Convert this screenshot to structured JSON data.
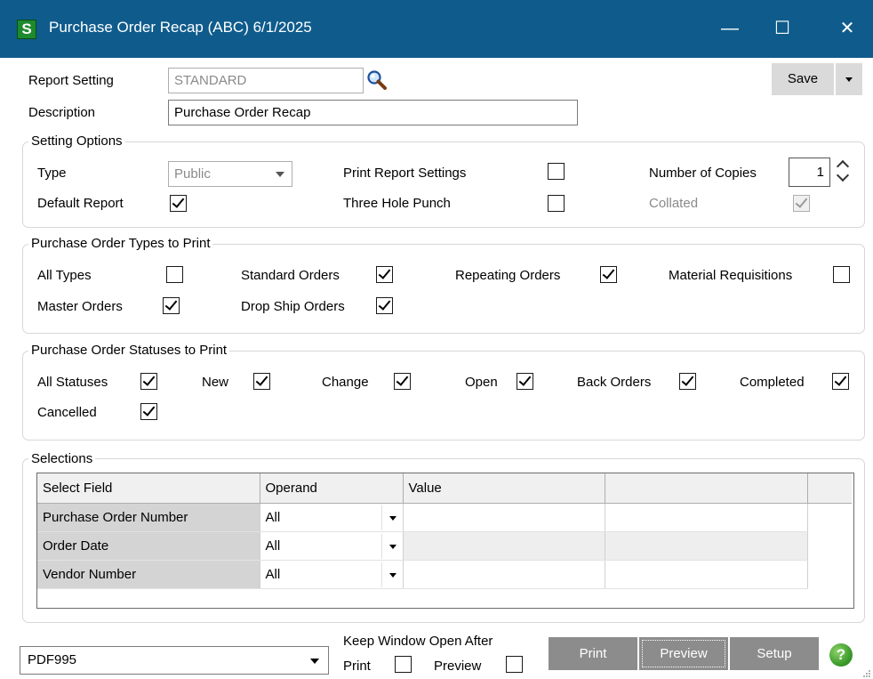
{
  "window": {
    "title": "Purchase Order Recap (ABC) 6/1/2025",
    "app_icon": "S",
    "minimize": "—",
    "maximize": "☐",
    "close": "✕"
  },
  "header": {
    "report_setting_label": "Report Setting",
    "report_setting_value": "STANDARD",
    "description_label": "Description",
    "description_value": "Purchase Order Recap",
    "save_label": "Save"
  },
  "setting_options": {
    "title": "Setting Options",
    "type_label": "Type",
    "type_value": "Public",
    "default_report_label": "Default Report",
    "default_report_checked": true,
    "print_report_settings_label": "Print Report Settings",
    "print_report_settings_checked": false,
    "three_hole_punch_label": "Three Hole Punch",
    "three_hole_punch_checked": false,
    "number_of_copies_label": "Number of Copies",
    "number_of_copies_value": "1",
    "collated_label": "Collated",
    "collated_checked": true
  },
  "order_types": {
    "title": "Purchase Order Types to Print",
    "items": [
      {
        "label": "All Types",
        "checked": false
      },
      {
        "label": "Standard Orders",
        "checked": true
      },
      {
        "label": "Repeating Orders",
        "checked": true
      },
      {
        "label": "Material Requisitions",
        "checked": false
      },
      {
        "label": "Master Orders",
        "checked": true
      },
      {
        "label": "Drop Ship Orders",
        "checked": true
      }
    ]
  },
  "order_statuses": {
    "title": "Purchase Order Statuses to Print",
    "items": [
      {
        "label": "All Statuses",
        "checked": true
      },
      {
        "label": "New",
        "checked": true
      },
      {
        "label": "Change",
        "checked": true
      },
      {
        "label": "Open",
        "checked": true
      },
      {
        "label": "Back Orders",
        "checked": true
      },
      {
        "label": "Completed",
        "checked": true
      },
      {
        "label": "Cancelled",
        "checked": true
      }
    ]
  },
  "selections": {
    "title": "Selections",
    "columns": [
      "Select Field",
      "Operand",
      "Value",
      ""
    ],
    "rows": [
      {
        "field": "Purchase Order Number",
        "operand": "All",
        "value": ""
      },
      {
        "field": "Order Date",
        "operand": "All",
        "value": ""
      },
      {
        "field": "Vendor Number",
        "operand": "All",
        "value": ""
      }
    ]
  },
  "footer": {
    "printer_value": "PDF995",
    "keep_open_label": "Keep Window Open After",
    "keep_print_label": "Print",
    "keep_print_checked": false,
    "keep_preview_label": "Preview",
    "keep_preview_checked": false,
    "print_button": "Print",
    "preview_button": "Preview",
    "setup_button": "Setup",
    "help_icon": "?"
  }
}
